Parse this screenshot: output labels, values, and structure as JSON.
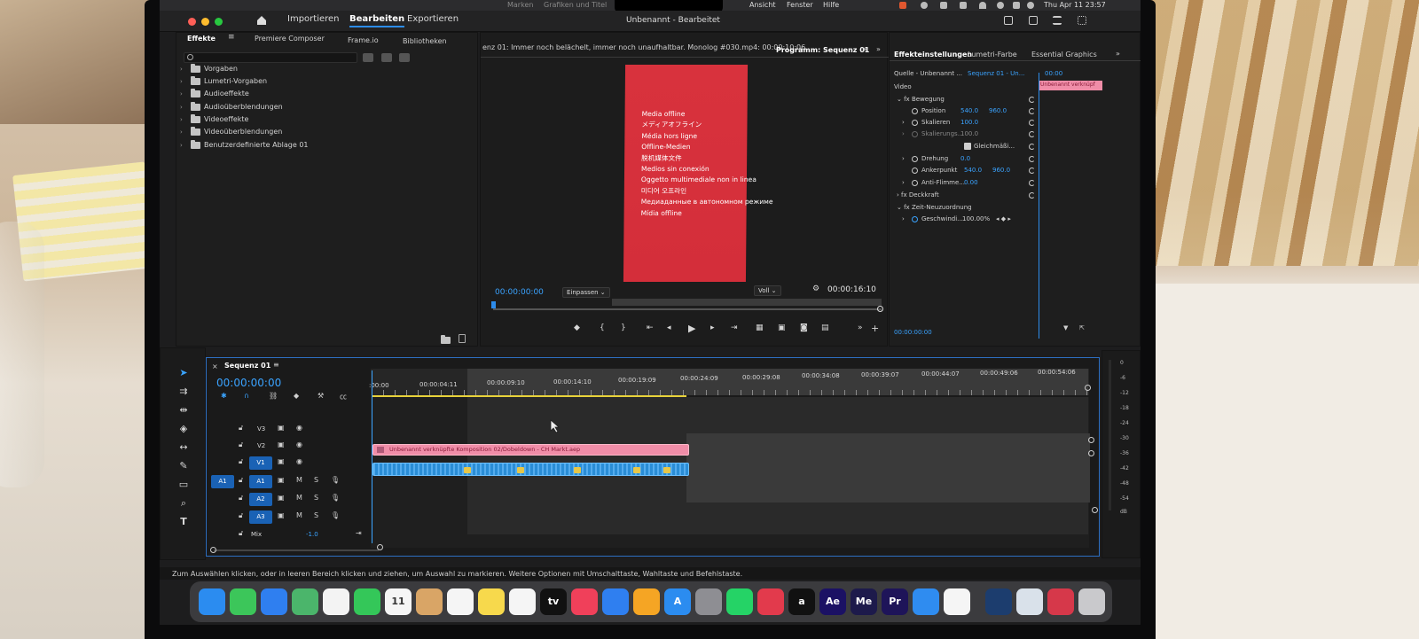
{
  "menubar": {
    "dim_left": "Marken",
    "dim_right": "Grafiken und Titel",
    "items": [
      "Ansicht",
      "Fenster",
      "Hilfe"
    ],
    "datetime": "Thu Apr 11  23:57"
  },
  "app": {
    "modes": [
      "Importieren",
      "Bearbeiten",
      "Exportieren"
    ],
    "title": "Unbenannt - Bearbeitet"
  },
  "effects_panel": {
    "tabs": [
      "Effekte",
      "Premiere Composer",
      "Frame.io",
      "Bibliotheken"
    ],
    "tree": [
      "Vorgaben",
      "Lumetri-Vorgaben",
      "Audioeffekte",
      "Audioüberblendungen",
      "Videoeffekte",
      "Videoüberblendungen",
      "Benutzerdefinierte Ablage 01"
    ]
  },
  "source_monitor": {
    "clip_title": "enz 01: Immer noch belächelt, immer noch unaufhaltbar. Monolog #030.mp4: 00:00:10:06"
  },
  "program_monitor": {
    "tab": "Programm: Sequenz 01",
    "offline_lines": [
      "Media offline",
      "メディアオフライン",
      "Média hors ligne",
      "Offline-Medien",
      "脱机媒体文件",
      "Medios sin conexión",
      "Oggetto multimediale non in linea",
      "미디어 오프라인",
      "Медиаданные в автономном режиме",
      "Mídia offline"
    ],
    "timecode_current": "00:00:00:00",
    "fit": "Einpassen",
    "quality": "Voll",
    "timecode_duration": "00:00:16:10"
  },
  "effect_controls": {
    "tabs": [
      "Effekteinstellungen",
      "Lumetri-Farbe",
      "Essential Graphics"
    ],
    "source": "Quelle - Unbenannt ...",
    "sequence": "Sequenz 01 - Un...",
    "mini_tc": "00:00",
    "clip_label": "Unbenannt verknüpf",
    "section_video": "Video",
    "motion": "Bewegung",
    "position_label": "Position",
    "position_x": "540.0",
    "position_y": "960.0",
    "scale_label": "Skalieren",
    "scale": "100.0",
    "scale_width_label": "Skalierungs...",
    "scale_width": "100.0",
    "uniform": "Gleichmäßi...",
    "rotation_label": "Drehung",
    "rotation": "0.0",
    "anchor_label": "Ankerpunkt",
    "anchor_x": "540.0",
    "anchor_y": "960.0",
    "antiflicker_label": "Anti-Flimme...",
    "antiflicker": "0.00",
    "opacity": "Deckkraft",
    "time_remap": "Zeit-Neuzuordnung",
    "speed_label": "Geschwindi...",
    "speed": "100.00%",
    "bottom_tc": "00:00:00:00"
  },
  "timeline": {
    "sequence_tab": "Sequenz 01",
    "timecode": "00:00:00:00",
    "ruler": [
      ":00:00",
      "00:00:04:11",
      "00:00:09:10",
      "00:00:14:10",
      "00:00:19:09",
      "00:00:24:09",
      "00:00:29:08",
      "00:00:34:08",
      "00:00:39:07",
      "00:00:44:07",
      "00:00:49:06",
      "00:00:54:06"
    ],
    "tracks": [
      {
        "name": "V3",
        "kind": "video"
      },
      {
        "name": "V2",
        "kind": "video"
      },
      {
        "name": "V1",
        "kind": "video"
      },
      {
        "name": "A1",
        "kind": "audio",
        "source": "A1"
      },
      {
        "name": "A2",
        "kind": "audio"
      },
      {
        "name": "A3",
        "kind": "audio"
      }
    ],
    "mix_label": "Mix",
    "mix_value": "-1.0",
    "video_clip": "Unbenannt verknüpfte Komposition 02/Dobeldown - CH Markt.aep",
    "meter_scale": [
      "0",
      "-6",
      "-12",
      "-18",
      "-24",
      "-30",
      "-36",
      "-42",
      "-48",
      "-54",
      "dB"
    ]
  },
  "status_bar": "Zum Auswählen klicken, oder in leeren Bereich klicken und ziehen, um Auswahl zu markieren. Weitere Optionen mit Umschalttaste, Wahltaste und Befehlstaste.",
  "dock": {
    "apps": [
      {
        "name": "finder",
        "color": "#2b8cf0",
        "label": ""
      },
      {
        "name": "messages",
        "color": "#3cc65a",
        "label": ""
      },
      {
        "name": "mail",
        "color": "#2f7ff0",
        "label": ""
      },
      {
        "name": "maps",
        "color": "#4bb56b",
        "label": ""
      },
      {
        "name": "photos",
        "color": "#f3f3f3",
        "label": ""
      },
      {
        "name": "facetime",
        "color": "#34c759",
        "label": ""
      },
      {
        "name": "calendar",
        "color": "#f5f5f5",
        "label": "11"
      },
      {
        "name": "contacts",
        "color": "#d9a566",
        "label": ""
      },
      {
        "name": "reminders",
        "color": "#f5f5f5",
        "label": ""
      },
      {
        "name": "notes",
        "color": "#f7d94c",
        "label": ""
      },
      {
        "name": "freeform",
        "color": "#f5f5f5",
        "label": ""
      },
      {
        "name": "tv",
        "color": "#111111",
        "label": "tv"
      },
      {
        "name": "music",
        "color": "#f0405a",
        "label": ""
      },
      {
        "name": "keynote",
        "color": "#2f7ff0",
        "label": ""
      },
      {
        "name": "pages",
        "color": "#f5a524",
        "label": ""
      },
      {
        "name": "app-store",
        "color": "#2b8cf0",
        "label": "A"
      },
      {
        "name": "system-settings",
        "color": "#8e8e93",
        "label": ""
      },
      {
        "name": "whatsapp",
        "color": "#25d366",
        "label": ""
      },
      {
        "name": "creative-cloud",
        "color": "#e23a4c",
        "label": ""
      },
      {
        "name": "threads",
        "color": "#111111",
        "label": "a"
      },
      {
        "name": "after-effects",
        "color": "#1b1164",
        "label": "Ae"
      },
      {
        "name": "media-encoder",
        "color": "#1d1a4b",
        "label": "Me"
      },
      {
        "name": "premiere-pro",
        "color": "#1e1459",
        "label": "Pr"
      },
      {
        "name": "safari",
        "color": "#2f8cf0",
        "label": ""
      },
      {
        "name": "capcut",
        "color": "#f5f5f5",
        "label": ""
      },
      {
        "name": "quicktime",
        "color": "#1c3d6e",
        "label": ""
      },
      {
        "name": "preview",
        "color": "#d9e1ea",
        "label": ""
      },
      {
        "name": "creative-cloud-2",
        "color": "#d6384a",
        "label": ""
      },
      {
        "name": "trash",
        "color": "#c9c9cc",
        "label": ""
      }
    ]
  }
}
